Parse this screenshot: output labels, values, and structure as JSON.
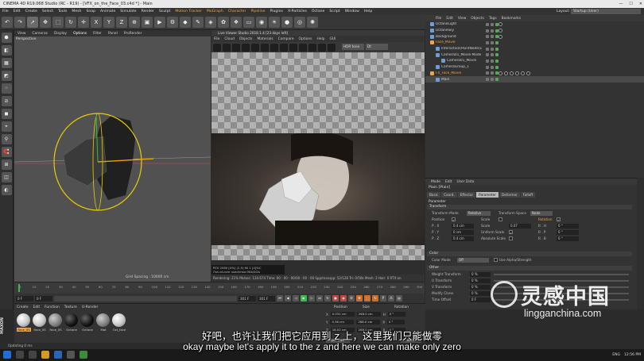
{
  "window": {
    "title": "CINEMA 4D R19.068 Studio (RC - R19) - [VFX_on_the_Face_03.c4d *] - Main",
    "layout_label": "Layout:",
    "layout_value": "Startup (User)"
  },
  "main_menu": [
    "File",
    "Edit",
    "Create",
    "Select",
    "Tools",
    "Mesh",
    "Snap",
    "Animate",
    "Simulate",
    "Render",
    "Sculpt",
    "Motion Tracker",
    "MoGraph",
    "Character",
    "Pipeline",
    "Plugins",
    "X-Particles",
    "Octane",
    "Script",
    "Window",
    "Help"
  ],
  "viewport": {
    "menu": [
      "View",
      "Cameras",
      "Display",
      "Options",
      "Filter",
      "Panel",
      "ProRender"
    ],
    "active_menu": "Options",
    "label": "Perspective",
    "grid_spacing": "Grid Spacing : 10000 cm"
  },
  "octane": {
    "title": "Live Viewer Studio 2018.1.4 [23 days left]",
    "menu": [
      "File",
      "Cloud",
      "Objects",
      "Materials",
      "Compare",
      "Options",
      "Help",
      "GUI"
    ],
    "dropdown1": "HDR tone",
    "dropdown2": "Dt",
    "stats": [
      "RTX 2080 [0%] (2.5)        Mi 1    [4]%C",
      "Out-of-core used/max:0Kb/4Gb",
      "Grey8/16: 0/0          Rgb32/64: 1/1",
      "Used/free/total vram: 1.422Gb/6.832Gb/8Gb"
    ],
    "status": "Rendering: 21%   Ms/sec: 134.674   Time: 00 : 00 : 00/00 : 00 : 00   Spp/maxspp: 52/128   Tri: 0/50k   Mesh: 2   Hair: 0   RTX:on"
  },
  "object_manager": {
    "menu": [
      "File",
      "Edit",
      "View",
      "Objects",
      "Tags",
      "Bookmarks"
    ],
    "objects": [
      {
        "name": "OctaneLight",
        "indent": 0,
        "selected": false,
        "highlight": false
      },
      {
        "name": "OctaneSky",
        "indent": 0,
        "selected": false,
        "highlight": false
      },
      {
        "name": "Background",
        "indent": 0,
        "selected": false,
        "highlight": false
      },
      {
        "name": "Face_Movie",
        "indent": 0,
        "selected": false,
        "highlight": true
      },
      {
        "name": "Interaction(PointNode)1",
        "indent": 1,
        "selected": false,
        "highlight": false
      },
      {
        "name": "Camera01_Movie Mode",
        "indent": 1,
        "selected": false,
        "highlight": false
      },
      {
        "name": "Camera01_Movie",
        "indent": 2,
        "selected": false,
        "highlight": false
      },
      {
        "name": "CameraGroup_1",
        "indent": 1,
        "selected": false,
        "highlight": false
      },
      {
        "name": "FX_Face_Movie",
        "indent": 0,
        "selected": false,
        "highlight": true
      },
      {
        "name": "Main",
        "indent": 1,
        "selected": true,
        "highlight": false
      }
    ]
  },
  "attributes": {
    "menu": [
      "Mode",
      "Edit",
      "User Data"
    ],
    "title": "Plain [Plain]",
    "tabs": [
      "Basic",
      "Coord.",
      "Effector",
      "Parameter",
      "Deformer",
      "Falloff"
    ],
    "active_tab": "Parameter",
    "parameter_label": "Parameter",
    "sections": {
      "transform": "Transform",
      "color": "Color",
      "other": "Other"
    },
    "transform_mode_label": "Transform Mode",
    "transform_mode_value": "Relative",
    "transform_space_label": "Transform Space",
    "transform_space_value": "Node",
    "position_label": "Position",
    "scale_label": "Scale",
    "rotation_label": "Rotation",
    "px": "0.4 cm",
    "py": "0 cm",
    "pz": "0.4 cm",
    "scale_value": "0.07",
    "sx": "",
    "uniform_scale": "Uniform Scale",
    "absolute_scale": "Absolute Scale",
    "rh": "0 °",
    "rp": "0 °",
    "rb": "0 °",
    "color_mode_label": "Color Mode",
    "color_mode_value": "Off",
    "use_alpha": "Use Alpha/Strength",
    "other_rows": [
      {
        "label": "Weight Transform",
        "value": "0 %"
      },
      {
        "label": "U Transform",
        "value": "0 %"
      },
      {
        "label": "V Transform",
        "value": "0 %"
      },
      {
        "label": "Modify Clone",
        "value": "0 %"
      },
      {
        "label": "Time Offset",
        "value": "0 F"
      }
    ]
  },
  "timeline": {
    "ticks": [
      "0",
      "10",
      "20",
      "30",
      "40",
      "50",
      "60",
      "70",
      "80",
      "90",
      "100",
      "110",
      "120",
      "130",
      "140",
      "150",
      "160",
      "170",
      "180",
      "190",
      "200",
      "210",
      "220",
      "230",
      "240",
      "250",
      "260",
      "270",
      "280",
      "290",
      "300"
    ],
    "start": "0 F",
    "current": "0 F",
    "end": "301 F",
    "end2": "301 F"
  },
  "material_manager": {
    "menu": [
      "Create",
      "Edit",
      "Function",
      "Texture",
      "U-Render"
    ],
    "materials": [
      {
        "label": "Face_0S",
        "style": "white",
        "selected": true
      },
      {
        "label": "Face_0S",
        "style": "white",
        "selected": false
      },
      {
        "label": "Face_0S",
        "style": "gray",
        "selected": false
      },
      {
        "label": "Octane",
        "style": "dark",
        "selected": false
      },
      {
        "label": "Octane",
        "style": "dark",
        "selected": false
      },
      {
        "label": "Mat",
        "style": "gray",
        "selected": false
      },
      {
        "label": "Oct_face",
        "style": "white",
        "selected": false
      }
    ]
  },
  "coordinates": {
    "headers": {
      "position": "Position",
      "size": "Size",
      "rotation": "Rotation"
    },
    "rows": [
      {
        "axis": "X",
        "pos": "0.031 cm",
        "size": "268.0 cm",
        "rot_axis": "H",
        "rot": "0 °"
      },
      {
        "axis": "Y",
        "pos": "0.36 cm",
        "size": "268.0 cm",
        "rot_axis": "P",
        "rot": "0 °"
      },
      {
        "axis": "Z",
        "pos": "16.02 cm",
        "size": "268.0 cm",
        "rot_axis": "B",
        "rot": "0 °"
      }
    ],
    "mode": "Object (Rel)",
    "apply": "Apply"
  },
  "brand": "MAXON",
  "status_bar": "Updating 0 ms",
  "subtitles": {
    "zh": "好吧，也许让我们把它应用到 z 上，这里我们只能做零",
    "en": "okay maybe let's apply it to the z and here we can make only zero"
  },
  "watermark": {
    "cn": "灵感中国",
    "en": "lingganchina.com"
  },
  "taskbar": {
    "lang": "ENG",
    "time": "12:56 PM"
  }
}
